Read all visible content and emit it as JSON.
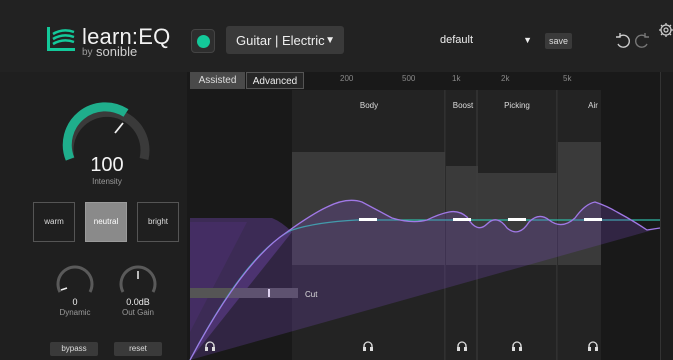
{
  "app": {
    "logo_text": "learn:EQ",
    "logo_by": "by",
    "logo_brand": "sonible",
    "power_on": true,
    "accent_color": "#13c99a",
    "profile": "Guitar | Electric",
    "preset": "default",
    "save_label": "save"
  },
  "left_panel": {
    "intensity_value": "100",
    "intensity_label": "Intensity",
    "intensity_level": 1.0,
    "tones": [
      "warm",
      "neutral",
      "bright"
    ],
    "selected_tone": "neutral",
    "dynamic_value": "0",
    "dynamic_label": "Dynamic",
    "gain_value": "0.0dB",
    "gain_label": "Out Gain",
    "bypass_label": "bypass",
    "reset_label": "reset"
  },
  "eq": {
    "tabs": [
      "Assisted",
      "Advanced"
    ],
    "active_tab": "Assisted",
    "freq_labels": [
      "200",
      "500",
      "1k",
      "2k",
      "5k"
    ],
    "bands": [
      "Body",
      "Boost",
      "Picking",
      "Air"
    ],
    "cut_label": "Cut",
    "curve_color": "#8b5cf6",
    "target_color": "#2fb6a4"
  }
}
